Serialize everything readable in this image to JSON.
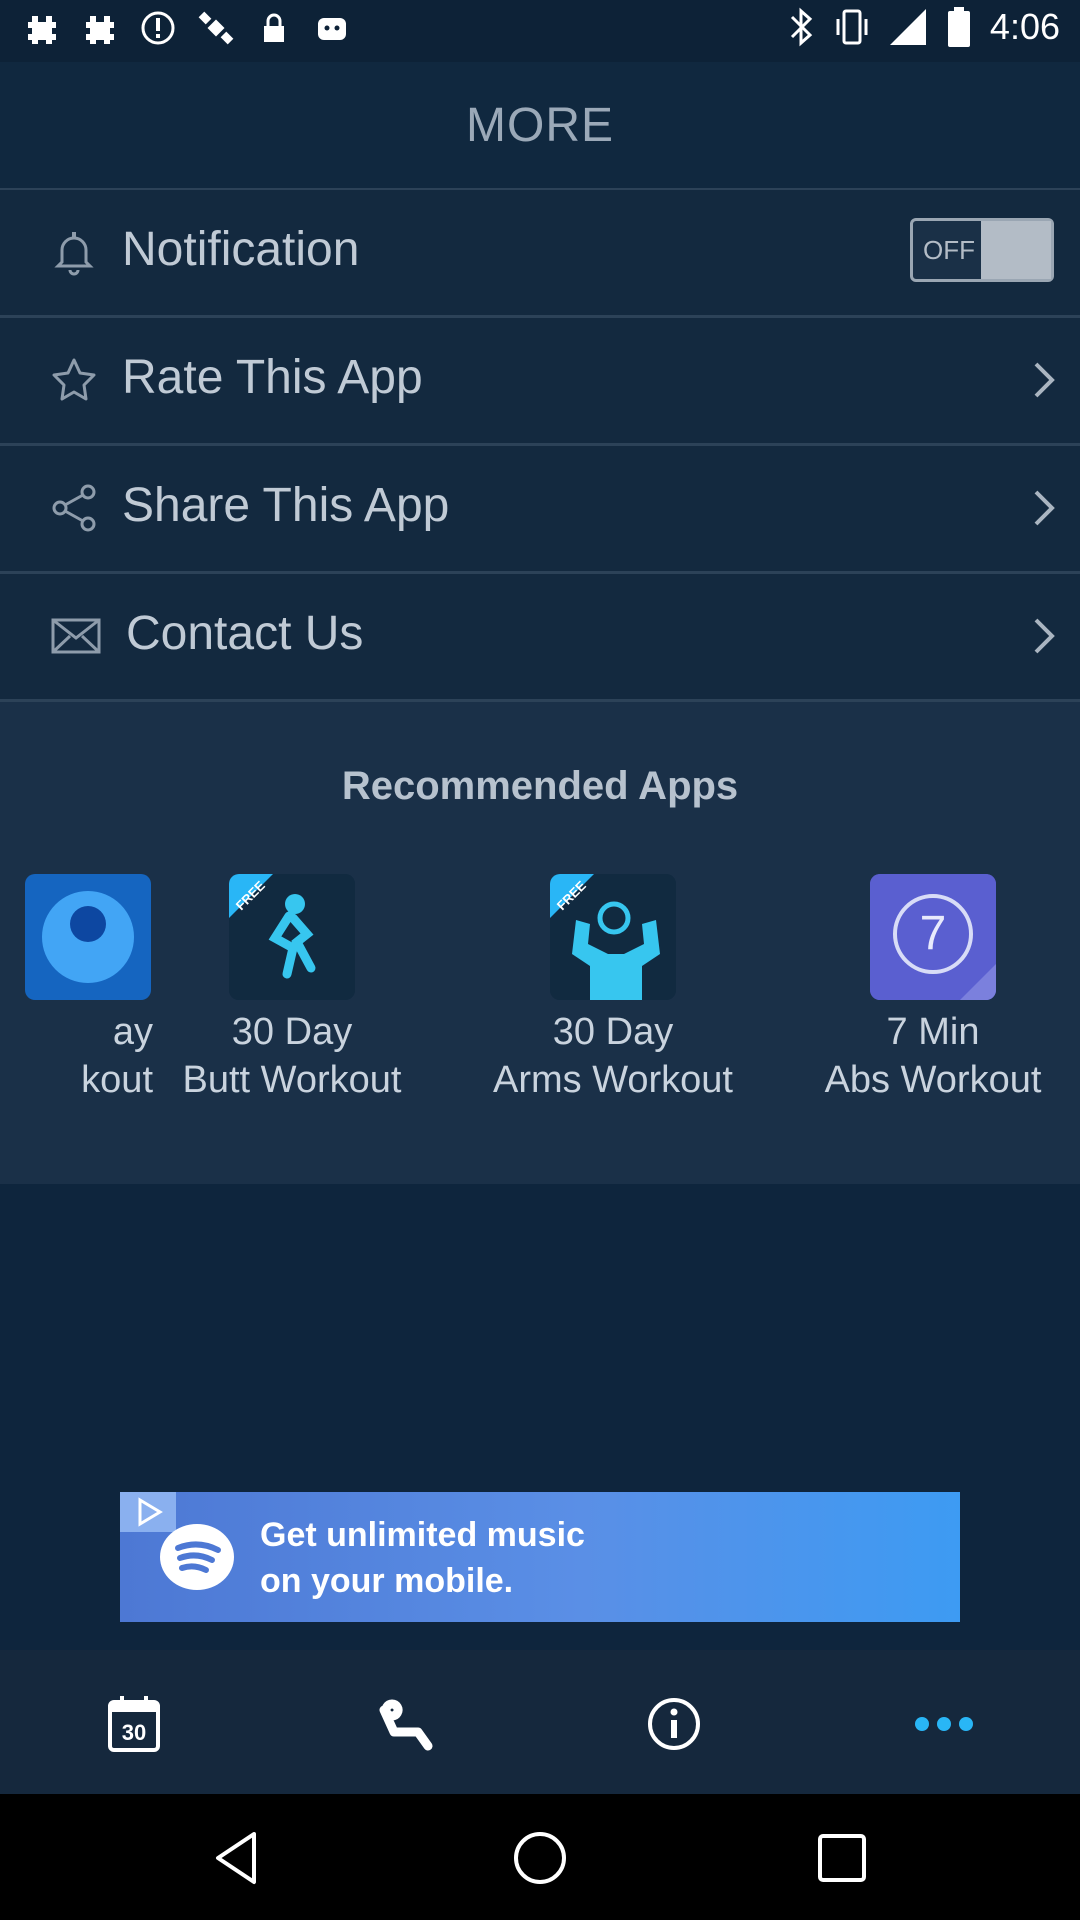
{
  "status_bar": {
    "time": "4:06",
    "left_icons": [
      "hashtag-icon",
      "hashtag-icon",
      "alert-icon",
      "satellite-icon",
      "lock-icon",
      "android-icon"
    ],
    "right_icons": [
      "bluetooth-icon",
      "vibrate-icon",
      "signal-icon",
      "battery-icon"
    ]
  },
  "header": {
    "title": "MORE"
  },
  "settings": {
    "notification": {
      "label": "Notification",
      "toggle_text": "OFF"
    },
    "rate": {
      "label": "Rate This App"
    },
    "share": {
      "label": "Share This App"
    },
    "contact": {
      "label": "Contact Us"
    }
  },
  "recommended": {
    "title": "Recommended Apps",
    "items": [
      {
        "line1": "ay",
        "line2": "kout"
      },
      {
        "line1": "30 Day",
        "line2": "Butt Workout"
      },
      {
        "line1": "30 Day",
        "line2": "Arms Workout"
      },
      {
        "line1": "7 Min",
        "line2": "Abs Workout"
      }
    ],
    "badge_text": "FREE",
    "abs_number": "7"
  },
  "ad": {
    "line1": "Get unlimited music",
    "line2": "on your mobile."
  },
  "tabbar": {
    "calendar_number": "30",
    "tabs": [
      "calendar-icon",
      "workout-icon",
      "info-icon",
      "more-icon"
    ]
  },
  "colors": {
    "accent": "#29b6f6",
    "background": "#0e253d"
  }
}
